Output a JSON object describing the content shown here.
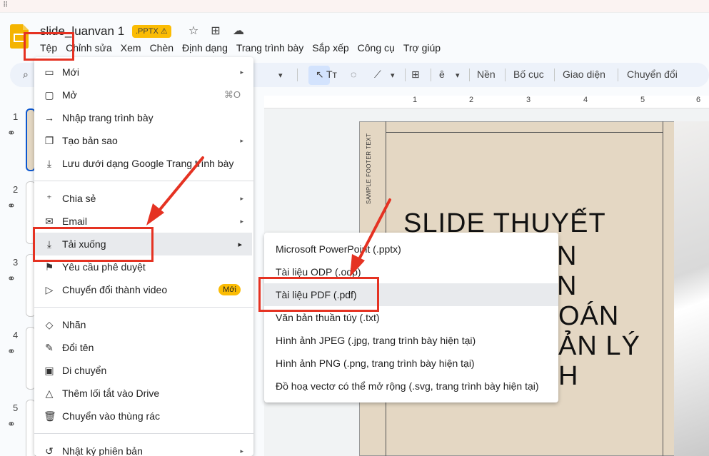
{
  "window": {
    "grid_glyph": "⠿"
  },
  "header": {
    "title": "slide_luanvan 1",
    "badge": ".PPTX ⚠",
    "star_glyph": "☆",
    "folder_glyph": "⊞",
    "cloud_glyph": "☁"
  },
  "menubar": {
    "items": [
      "Tệp",
      "Chỉnh sửa",
      "Xem",
      "Chèn",
      "Định dạng",
      "Trang trình bày",
      "Sắp xếp",
      "Công cụ",
      "Trợ giúp"
    ]
  },
  "toolbar": {
    "search_glyph": "⌕",
    "dropdown_glyph": "▾",
    "select_glyph": "↖",
    "text_glyph": "Tт",
    "shape_glyph": "◌",
    "line_glyph": "⟋",
    "comment_glyph": "⊞",
    "pen_glyph": "ȇ",
    "background": "Nền",
    "layout": "Bố cục",
    "theme": "Giao diện",
    "transition": "Chuyển đổi"
  },
  "ruler": {
    "ticks": [
      "1",
      "2",
      "3",
      "4",
      "5",
      "6"
    ]
  },
  "slide": {
    "footer_text": "SAMPLE FOOTER TEXT",
    "lines": [
      "SLIDE THUYẾT",
      "N",
      "N",
      "OÁN",
      "ẢN LÝ",
      "H"
    ]
  },
  "thumbnails": {
    "numbers": [
      "1",
      "2",
      "3",
      "4",
      "5"
    ],
    "link_glyph": "⚭"
  },
  "file_menu": {
    "items": [
      {
        "icon": "▭",
        "label": "Mới",
        "arrow": "▸"
      },
      {
        "icon": "▢",
        "label": "Mở",
        "shortcut": "⌘O"
      },
      {
        "icon": "→",
        "label": "Nhập trang trình bày"
      },
      {
        "icon": "❐",
        "label": "Tạo bản sao",
        "arrow": "▸"
      },
      {
        "icon": "⤓",
        "label": "Lưu dưới dạng Google Trang trình bày"
      },
      {
        "icon": "⁺",
        "label": "Chia sẻ",
        "arrow": "▸"
      },
      {
        "icon": "✉",
        "label": "Email",
        "arrow": "▸"
      },
      {
        "icon": "⤓",
        "label": "Tải xuống",
        "arrow": "▸"
      },
      {
        "icon": "⚑",
        "label": "Yêu cầu phê duyệt"
      },
      {
        "icon": "▷",
        "label": "Chuyển đổi thành video",
        "badge": "Mới"
      },
      {
        "icon": "◇",
        "label": "Nhãn"
      },
      {
        "icon": "✎",
        "label": "Đổi tên"
      },
      {
        "icon": "▣",
        "label": "Di chuyển"
      },
      {
        "icon": "△",
        "label": "Thêm lối tắt vào Drive"
      },
      {
        "icon": "🗑",
        "label": "Chuyển vào thùng rác"
      },
      {
        "icon": "↺",
        "label": "Nhật ký phiên bản",
        "arrow": "▸"
      }
    ]
  },
  "download_submenu": {
    "items": [
      "Microsoft PowerPoint (.pptx)",
      "Tài liệu ODP (.odp)",
      "Tài liệu PDF (.pdf)",
      "Văn bản thuần túy (.txt)",
      "Hình ảnh JPEG (.jpg, trang trình bày hiện tại)",
      "Hình ảnh PNG (.png, trang trình bày hiện tại)",
      "Đồ hoạ vectơ có thể mở rộng (.svg, trang trình bày hiện tại)"
    ]
  },
  "colors": {
    "annotation_red": "#e53222",
    "badge_yellow": "#fbbc04",
    "hover_gray": "#e8eaed",
    "slide_beige": "#e4d7c3",
    "accent_blue": "#0b57d0"
  }
}
